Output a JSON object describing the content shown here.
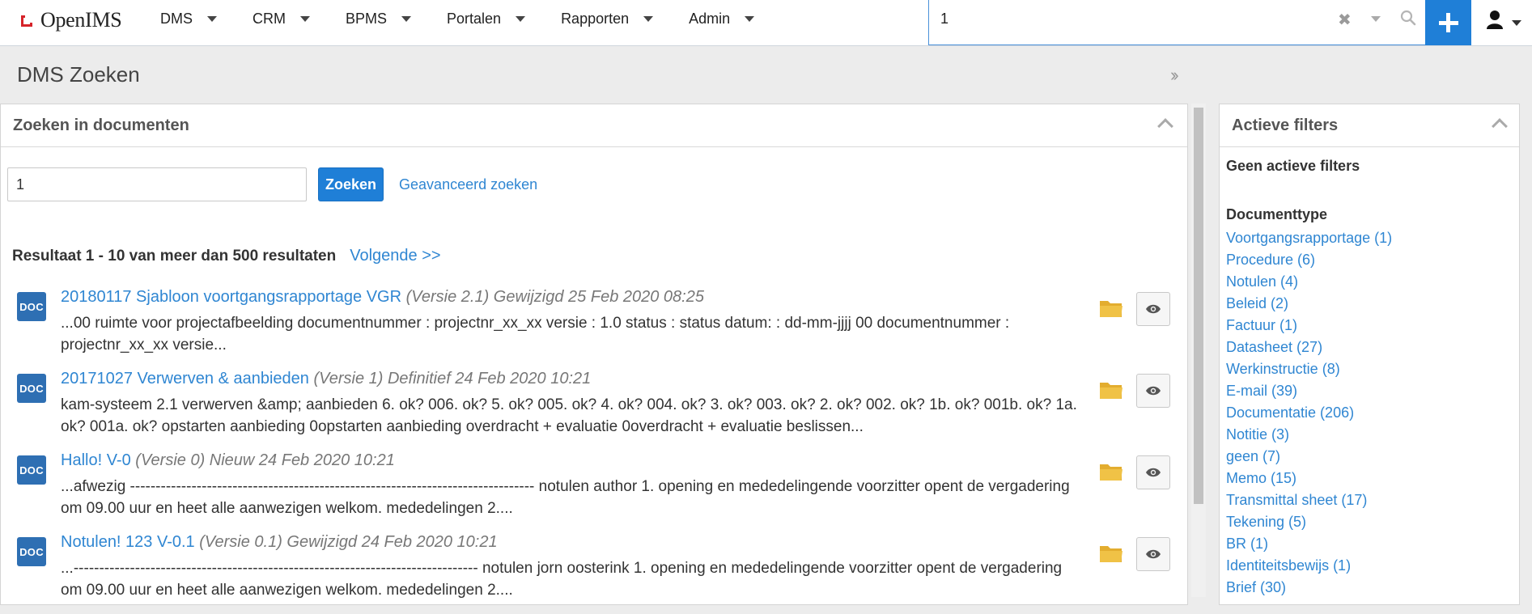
{
  "brand": {
    "name": "OpenIMS"
  },
  "nav": {
    "items": [
      {
        "label": "DMS"
      },
      {
        "label": "CRM"
      },
      {
        "label": "BPMS"
      },
      {
        "label": "Portalen"
      },
      {
        "label": "Rapporten"
      },
      {
        "label": "Admin"
      }
    ]
  },
  "top_search": {
    "value": "1"
  },
  "page": {
    "title": "DMS Zoeken"
  },
  "search_panel": {
    "title": "Zoeken in documenten",
    "query": "1",
    "search_button": "Zoeken",
    "advanced_link": "Geavanceerd zoeken",
    "summary": "Resultaat 1 - 10 van meer dan 500 resultaten",
    "next_link": "Volgende >>"
  },
  "results": [
    {
      "icon_label": "DOC",
      "title": "20180117 Sjabloon voortgangsrapportage VGR",
      "meta": "(Versie 2.1) Gewijzigd 25 Feb 2020 08:25",
      "snippet": "...00 ruimte voor projectafbeelding documentnummer : projectnr_xx_xx versie : 1.0 status : status datum: : dd-mm-jjjj 00 documentnummer : projectnr_xx_xx versie..."
    },
    {
      "icon_label": "DOC",
      "title": "20171027 Verwerven & aanbieden",
      "meta": "(Versie 1) Definitief 24 Feb 2020 10:21",
      "snippet": "kam-systeem 2.1 verwerven &amp; aanbieden 6. ok? 006. ok? 5. ok? 005. ok? 4. ok? 004. ok? 3. ok? 003. ok? 2. ok? 002. ok? 1b. ok? 001b. ok? 1a. ok? 001a. ok? opstarten aanbieding 0opstarten aanbieding overdracht + evaluatie 0overdracht + evaluatie beslissen..."
    },
    {
      "icon_label": "DOC",
      "title": "Hallo! V-0",
      "meta": "(Versie 0) Nieuw 24 Feb 2020 10:21",
      "snippet": "...afwezig ------------------------------------------------------------------------------- notulen author 1. opening en mededelingende voorzitter opent de vergadering om 09.00 uur en heet alle aanwezigen welkom. mededelingen 2...."
    },
    {
      "icon_label": "DOC",
      "title": "Notulen! 123 V-0.1",
      "meta": "(Versie 0.1) Gewijzigd 24 Feb 2020 10:21",
      "snippet": "...------------------------------------------------------------------------------- notulen jorn oosterink 1. opening en mededelingende voorzitter opent de vergadering om 09.00 uur en heet alle aanwezigen welkom. mededelingen 2...."
    }
  ],
  "filters_panel": {
    "title": "Actieve filters",
    "no_filters": "Geen actieve filters",
    "facet_title": "Documenttype",
    "facets": [
      "Voortgangsrapportage (1)",
      "Procedure (6)",
      "Notulen (4)",
      "Beleid (2)",
      "Factuur (1)",
      "Datasheet (27)",
      "Werkinstructie (8)",
      "E-mail (39)",
      "Documentatie (206)",
      "Notitie (3)",
      "geen (7)",
      "Memo (15)",
      "Transmittal sheet (17)",
      "Tekening (5)",
      "BR (1)",
      "Identiteitsbewijs (1)",
      "Brief (30)"
    ]
  },
  "colors": {
    "accent": "#1f7fd7",
    "link": "#2f86d2",
    "brand_red": "#d6232a",
    "doc_icon": "#2e6fb3"
  },
  "icons": [
    "brand-logo-icon",
    "chevron-down-icon",
    "clear-icon",
    "search-icon",
    "plus-icon",
    "user-icon",
    "double-chevron-right-icon",
    "chevron-up-icon",
    "folder-icon",
    "eye-icon"
  ]
}
